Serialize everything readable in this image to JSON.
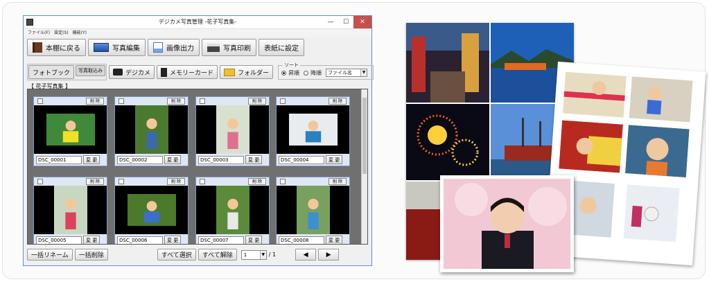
{
  "window": {
    "title": "デジカメ写真管理 -花子写真集-",
    "controls": {
      "minimize": "—",
      "maximize": "☐",
      "close": "✕"
    }
  },
  "menu": {
    "file": "ファイル(F)",
    "settings": "設定(S)",
    "tools": "機能(Y)"
  },
  "toolbar": {
    "back_to_shelf": "本棚に戻る",
    "photo_edit": "写真編集",
    "image_export": "画像出力",
    "photo_print": "写真印刷",
    "set_cover": "表紙に設定"
  },
  "import_bar": {
    "photobook": "フォトブック",
    "import_photos": "写真取込み",
    "digicam": "デジカメ",
    "memory_card": "メモリーカード",
    "folder": "フォルダー"
  },
  "sort": {
    "label": "ソート",
    "ascending": "昇順",
    "descending": "降順",
    "field": "ファイル名",
    "selected": "ascending"
  },
  "album_title": "【 花子写真集 】",
  "photo_card": {
    "delete_label": "削 除",
    "change_label": "変 更"
  },
  "photos": [
    {
      "filename": "DSC_00001",
      "orientation": "landscape"
    },
    {
      "filename": "DSC_00002",
      "orientation": "portrait"
    },
    {
      "filename": "DSC_00003",
      "orientation": "portrait"
    },
    {
      "filename": "DSC_00004",
      "orientation": "landscape"
    },
    {
      "filename": "DSC_00005",
      "orientation": "portrait"
    },
    {
      "filename": "DSC_00006",
      "orientation": "landscape"
    },
    {
      "filename": "DSC_00007",
      "orientation": "portrait"
    },
    {
      "filename": "DSC_00008",
      "orientation": "portrait"
    }
  ],
  "bottom_bar": {
    "batch_rename": "一括リネーム",
    "batch_delete": "一括削除",
    "select_all": "すべて選択",
    "deselect_all": "すべて解除",
    "page": "1",
    "total_pages": "/ 1",
    "prev_icon": "◀",
    "next_icon": "▶"
  },
  "colors": {
    "window_border": "#5a8fd6",
    "close_button": "#c7504a",
    "gallery_bg": "#707070",
    "card_header": "#dfe7f5"
  }
}
